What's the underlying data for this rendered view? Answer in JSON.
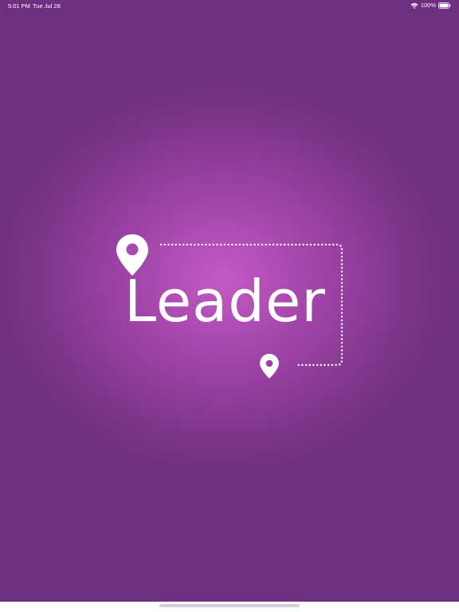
{
  "status_bar": {
    "time": "5:01 PM",
    "date": "Tue Jul 28",
    "battery_percent": "100%",
    "icons": [
      "wifi-icon",
      "battery-icon"
    ]
  },
  "logo": {
    "word": "Leader",
    "icons": [
      "location-pin-icon",
      "location-pin-icon",
      "dotted-route-icon"
    ]
  },
  "colors": {
    "background_center": "#c45ac4",
    "background_edge": "#6e2f80",
    "foreground": "#ffffff"
  }
}
